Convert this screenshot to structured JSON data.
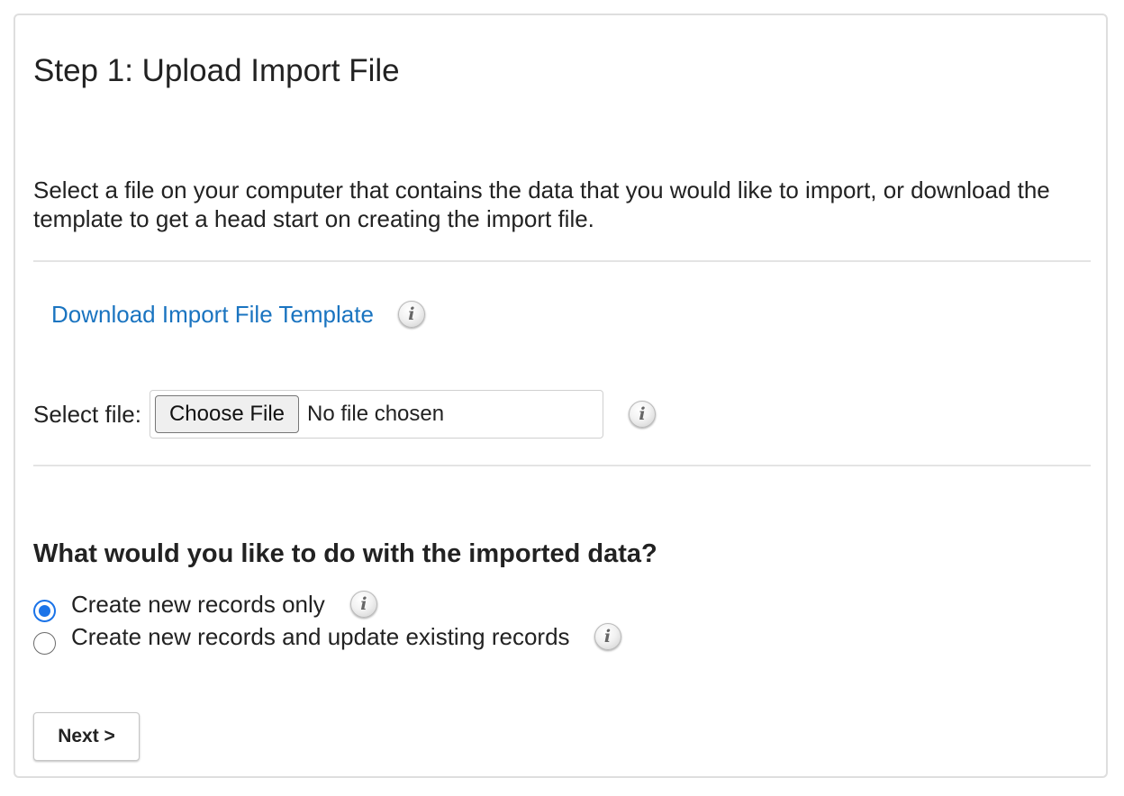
{
  "step": {
    "title": "Step 1: Upload Import File",
    "description": "Select a file on your computer that contains the data that you would like to import, or download the template to get a head start on creating the import file."
  },
  "download": {
    "link_label": "Download Import File Template",
    "info_icon": "info-icon"
  },
  "file_input": {
    "label": "Select file:",
    "button_label": "Choose File",
    "status": "No file chosen",
    "info_icon": "info-icon"
  },
  "import_mode": {
    "question": "What would you like to do with the imported data?",
    "options": [
      {
        "label": "Create new records only",
        "selected": true,
        "info_icon": "info-icon"
      },
      {
        "label": "Create new records and update existing records",
        "selected": false,
        "info_icon": "info-icon"
      }
    ]
  },
  "info_glyph": "i",
  "actions": {
    "next_label": "Next >"
  },
  "colors": {
    "link": "#1a74c0",
    "radio_selected": "#1a73e8",
    "panel_border": "#dedede",
    "divider": "#e4e4e4"
  }
}
